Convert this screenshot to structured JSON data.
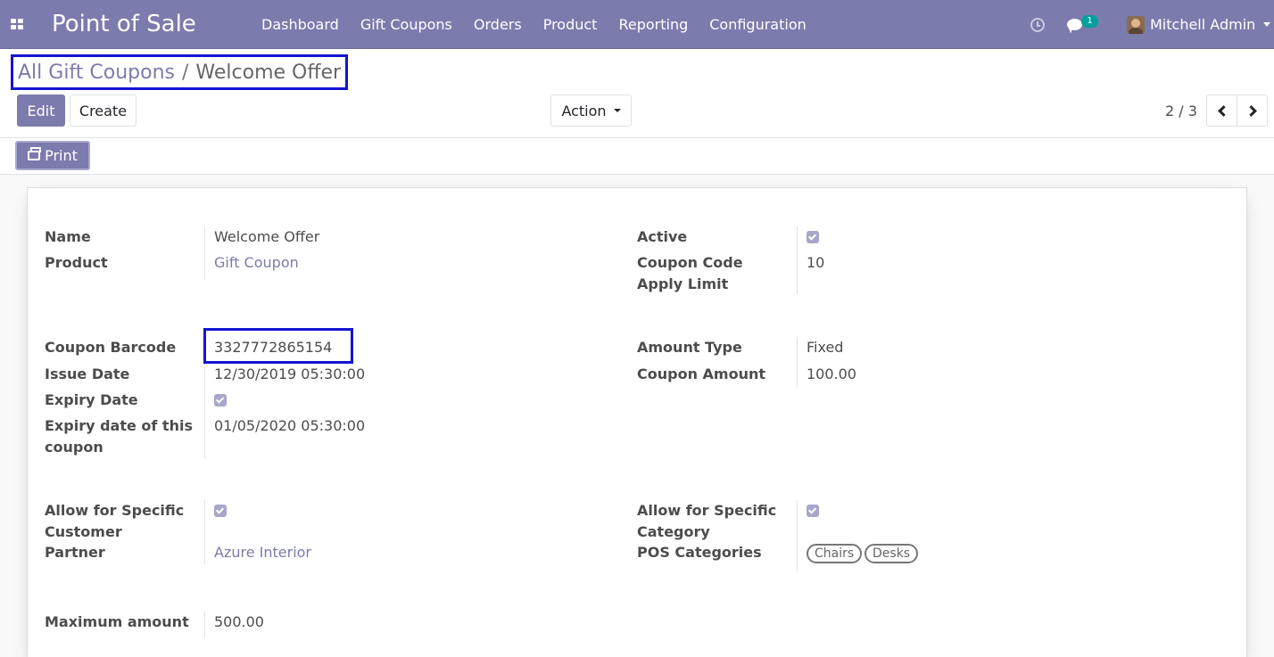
{
  "navbar": {
    "app_title": "Point of Sale",
    "menu": [
      "Dashboard",
      "Gift Coupons",
      "Orders",
      "Product",
      "Reporting",
      "Configuration"
    ],
    "chat_count": "1",
    "user_name": "Mitchell Admin"
  },
  "breadcrumb": {
    "parent": "All Gift Coupons",
    "separator": "/",
    "current": "Welcome Offer"
  },
  "toolbar": {
    "edit_label": "Edit",
    "create_label": "Create",
    "action_label": "Action",
    "pager": "2 / 3"
  },
  "statusbar": {
    "print_label": "Print"
  },
  "form": {
    "name_label": "Name",
    "name_value": "Welcome Offer",
    "product_label": "Product",
    "product_value": "Gift Coupon",
    "active_label": "Active",
    "active_checked": true,
    "coupon_code_label": "Coupon Code",
    "apply_limit_label": "Apply Limit",
    "apply_limit_value": "10",
    "barcode_label": "Coupon Barcode",
    "barcode_value": "3327772865154",
    "issue_date_label": "Issue Date",
    "issue_date_value": "12/30/2019 05:30:00",
    "expiry_date_label": "Expiry Date",
    "expiry_date_checked": true,
    "expiry_of_coupon_label_1": "Expiry date of this",
    "expiry_of_coupon_label_2": "coupon",
    "expiry_of_coupon_value": "01/05/2020 05:30:00",
    "amount_type_label": "Amount Type",
    "amount_type_value": "Fixed",
    "coupon_amount_label": "Coupon Amount",
    "coupon_amount_value": "100.00",
    "specific_customer_label_1": "Allow for Specific",
    "specific_customer_label_2": "Customer",
    "specific_customer_checked": true,
    "partner_label": "Partner",
    "partner_value": "Azure Interior",
    "specific_category_label_1": "Allow for Specific",
    "specific_category_label_2": "Category",
    "specific_category_checked": true,
    "pos_categories_label": "POS Categories",
    "pos_categories": [
      "Chairs",
      "Desks"
    ],
    "max_amount_label": "Maximum amount",
    "max_amount_value": "500.00"
  },
  "colors": {
    "brand": "#7c7bad",
    "highlight_box": "#1414d2",
    "badge": "#00a09d"
  }
}
